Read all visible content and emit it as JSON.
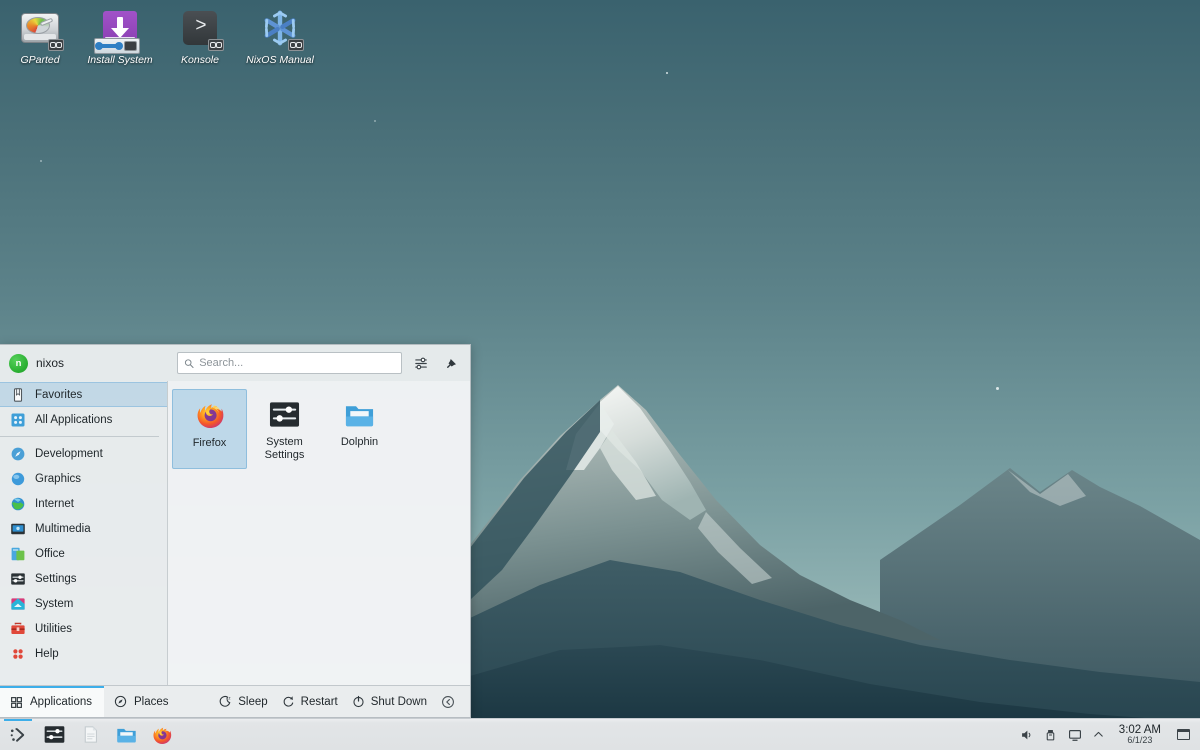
{
  "desktop": {
    "icons": [
      {
        "label": "GParted",
        "icon": "hard-disk-icon"
      },
      {
        "label": "Install System",
        "icon": "installer-download-icon"
      },
      {
        "label": "Konsole",
        "icon": "terminal-icon"
      },
      {
        "label": "NixOS Manual",
        "icon": "nixos-snowflake-icon"
      }
    ]
  },
  "kickoff": {
    "user": {
      "name": "nixos",
      "avatar_initial": "n"
    },
    "search": {
      "placeholder": "Search...",
      "value": ""
    },
    "header_buttons": [
      {
        "name": "configure-icon",
        "tooltip": "Configure"
      },
      {
        "name": "pin-icon",
        "tooltip": "Pin"
      }
    ],
    "sidebar": [
      {
        "label": "Favorites",
        "icon": "bookmark-icon",
        "selected": true
      },
      {
        "label": "All Applications",
        "icon": "grid-apps-icon",
        "selected": false
      },
      {
        "label": "Development",
        "icon": "development-icon",
        "selected": false
      },
      {
        "label": "Graphics",
        "icon": "graphics-icon",
        "selected": false
      },
      {
        "label": "Internet",
        "icon": "internet-icon",
        "selected": false
      },
      {
        "label": "Multimedia",
        "icon": "multimedia-icon",
        "selected": false
      },
      {
        "label": "Office",
        "icon": "office-icon",
        "selected": false
      },
      {
        "label": "Settings",
        "icon": "settings-icon",
        "selected": false
      },
      {
        "label": "System",
        "icon": "system-icon",
        "selected": false
      },
      {
        "label": "Utilities",
        "icon": "utilities-toolbox-icon",
        "selected": false
      },
      {
        "label": "Help",
        "icon": "help-icon",
        "selected": false
      }
    ],
    "favorites": [
      {
        "label": "Firefox",
        "icon": "firefox-icon",
        "selected": true
      },
      {
        "label": "System Settings",
        "icon": "system-settings-icon",
        "selected": false
      },
      {
        "label": "Dolphin",
        "icon": "folder-icon",
        "selected": false
      }
    ],
    "footer": {
      "tabs": [
        {
          "label": "Applications",
          "icon": "grid-icon",
          "active": true
        },
        {
          "label": "Places",
          "icon": "compass-icon",
          "active": false
        }
      ],
      "power": [
        {
          "label": "Sleep",
          "icon": "moon-icon"
        },
        {
          "label": "Restart",
          "icon": "restart-icon"
        },
        {
          "label": "Shut Down",
          "icon": "power-icon"
        }
      ],
      "leave_icon": "leave-icon"
    }
  },
  "panel": {
    "launchers": [
      {
        "name": "kickoff-launcher",
        "icon": "nixos-menu-icon"
      },
      {
        "name": "konsole-launcher",
        "icon": "terminal-icon"
      },
      {
        "name": "document-launcher",
        "icon": "document-icon"
      },
      {
        "name": "dolphin-launcher",
        "icon": "folder-icon"
      },
      {
        "name": "firefox-launcher",
        "icon": "firefox-icon"
      }
    ],
    "systray": [
      {
        "name": "volume-icon"
      },
      {
        "name": "usb-device-icon"
      },
      {
        "name": "display-icon"
      },
      {
        "name": "expand-tray-icon"
      }
    ],
    "clock": {
      "time": "3:02 AM",
      "date": "6/1/23"
    },
    "show_desktop": {
      "name": "show-desktop-button"
    }
  },
  "colors": {
    "accent": "#3daee9",
    "panel_bg": "#e2e5e7",
    "menu_bg": "#eff1f2",
    "avatar_green": "#2bb033",
    "sky_top": "#3a626e",
    "sky_bottom": "#aecac7"
  }
}
